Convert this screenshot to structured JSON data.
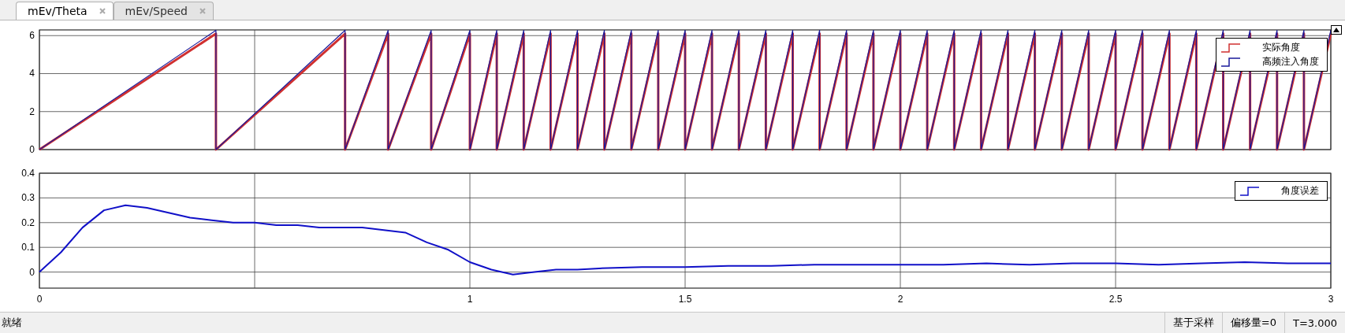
{
  "tabs": [
    {
      "label": "mEv/Theta",
      "selected": true
    },
    {
      "label": "mEv/Speed",
      "selected": false
    }
  ],
  "plots": [
    {
      "chart_data": {
        "type": "line",
        "grid": true,
        "x": [
          0,
          0.41,
          0.41,
          0.71,
          0.71,
          0.81,
          0.81,
          0.91,
          0.91,
          1.0,
          1.0,
          1.0625,
          1.0625,
          1.125,
          1.125,
          1.1875,
          1.1875,
          1.25,
          1.25,
          1.3125,
          1.3125,
          1.375,
          1.375,
          1.4375,
          1.4375,
          1.5,
          1.5,
          1.5625,
          1.5625,
          1.625,
          1.625,
          1.6875,
          1.6875,
          1.75,
          1.75,
          1.8125,
          1.8125,
          1.875,
          1.875,
          1.9375,
          1.9375,
          2.0,
          2.0,
          2.0625,
          2.0625,
          2.125,
          2.125,
          2.1875,
          2.1875,
          2.25,
          2.25,
          2.3125,
          2.3125,
          2.375,
          2.375,
          2.4375,
          2.4375,
          2.5,
          2.5,
          2.5625,
          2.5625,
          2.625,
          2.625,
          2.6875,
          2.6875,
          2.75,
          2.75,
          2.8125,
          2.8125,
          2.875,
          2.875,
          2.9375,
          2.9375,
          3.0
        ],
        "series": [
          {
            "name": "实际角度",
            "color": "#d03030",
            "values": [
              0,
              6.1,
              0,
              6.1,
              0,
              6.1,
              0,
              6.1,
              0,
              6.1,
              0,
              6.1,
              0,
              6.1,
              0,
              6.1,
              0,
              6.1,
              0,
              6.1,
              0,
              6.1,
              0,
              6.1,
              0,
              6.1,
              0,
              6.1,
              0,
              6.1,
              0,
              6.1,
              0,
              6.1,
              0,
              6.1,
              0,
              6.1,
              0,
              6.1,
              0,
              6.1,
              0,
              6.1,
              0,
              6.1,
              0,
              6.1,
              0,
              6.1,
              0,
              6.1,
              0,
              6.1,
              0,
              6.1,
              0,
              6.1,
              0,
              6.1,
              0,
              6.1,
              0,
              6.1,
              0,
              6.1,
              0,
              6.1,
              0,
              6.1,
              0,
              6.1,
              0,
              6.1
            ]
          },
          {
            "name": "高频注入角度",
            "color": "#1a1a9a",
            "values": [
              0,
              6.28,
              0,
              6.28,
              0,
              6.28,
              0,
              6.28,
              0,
              6.28,
              0,
              6.28,
              0,
              6.28,
              0,
              6.28,
              0,
              6.28,
              0,
              6.28,
              0,
              6.28,
              0,
              6.28,
              0,
              6.28,
              0,
              6.28,
              0,
              6.28,
              0,
              6.28,
              0,
              6.28,
              0,
              6.28,
              0,
              6.28,
              0,
              6.28,
              0,
              6.28,
              0,
              6.28,
              0,
              6.28,
              0,
              6.28,
              0,
              6.28,
              0,
              6.28,
              0,
              6.28,
              0,
              6.28,
              0,
              6.28,
              0,
              6.28,
              0,
              6.28,
              0,
              6.28,
              0,
              6.28,
              0,
              6.28,
              0,
              6.28,
              0,
              6.28,
              0,
              6.28
            ]
          }
        ],
        "xlim": [
          0,
          3
        ],
        "ylim": [
          0,
          6.3
        ],
        "yticks": [
          0,
          2,
          4,
          6
        ]
      }
    },
    {
      "chart_data": {
        "type": "line",
        "grid": true,
        "x": [
          0,
          0.05,
          0.1,
          0.15,
          0.2,
          0.25,
          0.3,
          0.35,
          0.4,
          0.45,
          0.5,
          0.55,
          0.6,
          0.65,
          0.7,
          0.75,
          0.8,
          0.85,
          0.9,
          0.95,
          1.0,
          1.05,
          1.1,
          1.15,
          1.2,
          1.25,
          1.3,
          1.4,
          1.5,
          1.6,
          1.7,
          1.8,
          1.9,
          2.0,
          2.1,
          2.2,
          2.3,
          2.4,
          2.5,
          2.6,
          2.7,
          2.8,
          2.9,
          3.0
        ],
        "series": [
          {
            "name": "角度误差",
            "color": "#1010c8",
            "values": [
              0,
              0.08,
              0.18,
              0.25,
              0.27,
              0.26,
              0.24,
              0.22,
              0.21,
              0.2,
              0.2,
              0.19,
              0.19,
              0.18,
              0.18,
              0.18,
              0.17,
              0.16,
              0.12,
              0.09,
              0.04,
              0.01,
              -0.01,
              0.0,
              0.01,
              0.01,
              0.015,
              0.02,
              0.02,
              0.025,
              0.025,
              0.03,
              0.03,
              0.03,
              0.03,
              0.035,
              0.03,
              0.035,
              0.035,
              0.03,
              0.035,
              0.04,
              0.035,
              0.035
            ]
          }
        ],
        "xlim": [
          0,
          3
        ],
        "ylim": [
          -0.065,
          0.4
        ],
        "xticks": [
          0,
          1,
          1.5,
          2,
          2.5,
          3
        ],
        "yticks": [
          0,
          0.1,
          0.2,
          0.3,
          0.4
        ]
      }
    }
  ],
  "status_bar": {
    "left": "就绪",
    "fields": [
      "基于采样",
      "偏移量=0",
      "T=3.000"
    ]
  }
}
